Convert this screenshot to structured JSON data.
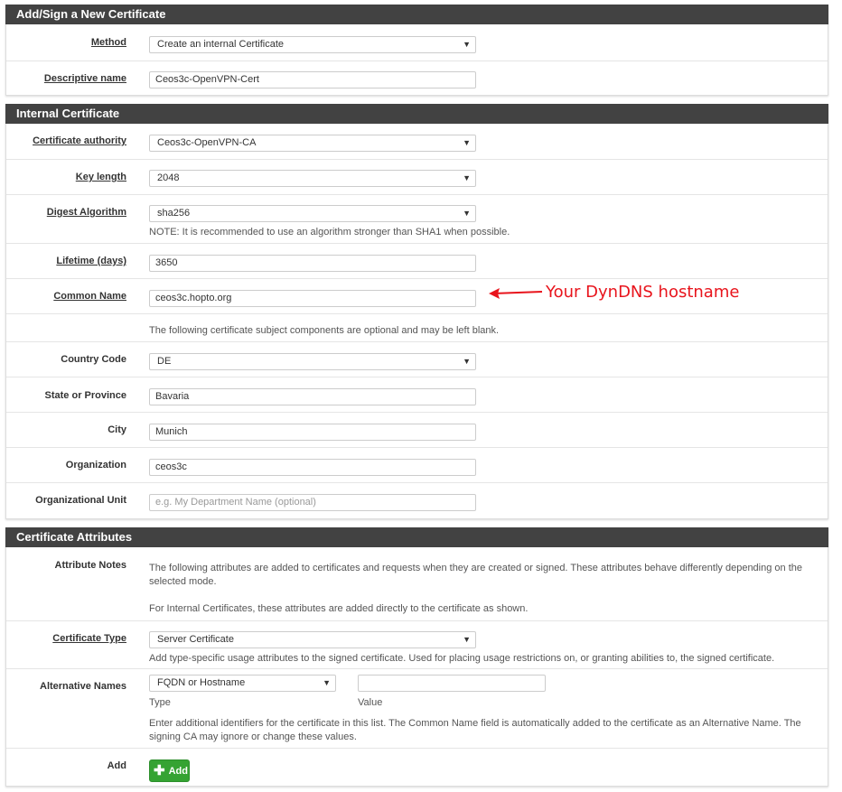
{
  "section1": {
    "title": "Add/Sign a New Certificate",
    "method_label": "Method",
    "method_value": "Create an internal Certificate",
    "descr_label": "Descriptive name",
    "descr_value": "Ceos3c-OpenVPN-Cert"
  },
  "section2": {
    "title": "Internal Certificate",
    "ca_label": "Certificate authority",
    "ca_value": "Ceos3c-OpenVPN-CA",
    "keylen_label": "Key length",
    "keylen_value": "2048",
    "digest_label": "Digest Algorithm",
    "digest_value": "sha256",
    "digest_help": "NOTE: It is recommended to use an algorithm stronger than SHA1 when possible.",
    "lifetime_label": "Lifetime (days)",
    "lifetime_value": "3650",
    "cn_label": "Common Name",
    "cn_value": "ceos3c.hopto.org",
    "optional_help": "The following certificate subject components are optional and may be left blank.",
    "country_label": "Country Code",
    "country_value": "DE",
    "state_label": "State or Province",
    "state_value": "Bavaria",
    "city_label": "City",
    "city_value": "Munich",
    "org_label": "Organization",
    "org_value": "ceos3c",
    "ou_label": "Organizational Unit",
    "ou_placeholder": "e.g. My Department Name (optional)"
  },
  "annotation": {
    "text": "Your DynDNS hostname",
    "color": "#e8141c"
  },
  "section3": {
    "title": "Certificate Attributes",
    "notes_label": "Attribute Notes",
    "notes_help1": "The following attributes are added to certificates and requests when they are created or signed. These attributes behave differently depending on the selected mode.",
    "notes_help2": "For Internal Certificates, these attributes are added directly to the certificate as shown.",
    "type_label": "Certificate Type",
    "type_value": "Server Certificate",
    "type_help": "Add type-specific usage attributes to the signed certificate. Used for placing usage restrictions on, or granting abilities to, the signed certificate.",
    "alt_label": "Alternative Names",
    "alt_type_value": "FQDN or Hostname",
    "alt_type_sub": "Type",
    "alt_value_sub": "Value",
    "alt_value": "",
    "alt_help": "Enter additional identifiers for the certificate in this list. The Common Name field is automatically added to the certificate as an Alternative Name. The signing CA may ignore or change these values.",
    "add_label": "Add",
    "add_button": "Add"
  },
  "colors": {
    "panel_header": "#424242",
    "add_button": "#35a333"
  }
}
